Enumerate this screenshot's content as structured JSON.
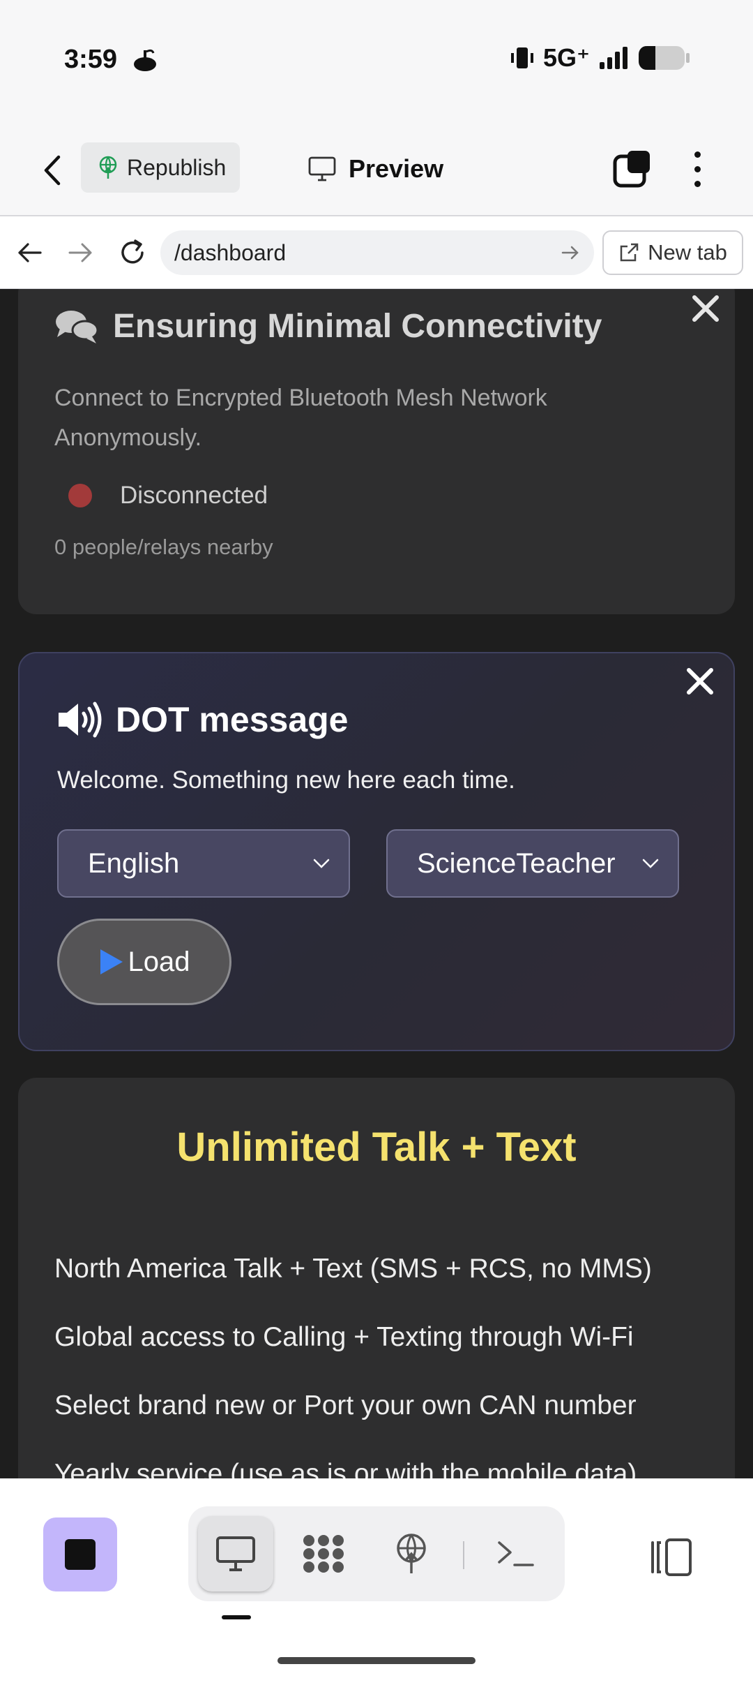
{
  "status_bar": {
    "time": "3:59",
    "network": "5G⁺"
  },
  "editor_header": {
    "republish_label": "Republish",
    "preview_label": "Preview"
  },
  "address_bar": {
    "url": "/dashboard",
    "new_tab_label": "New tab"
  },
  "connectivity_card": {
    "title": "Ensuring Minimal Connectivity",
    "description": "Connect to Encrypted Bluetooth Mesh Network Anonymously.",
    "status": "Disconnected",
    "status_color": "#a23a3a",
    "nearby_count": "0 people/relays nearby"
  },
  "dot_card": {
    "title": "DOT message",
    "description": "Welcome. Something new here each time.",
    "language_selected": "English",
    "persona_selected": "ScienceTeacher",
    "load_label": "Load",
    "play_icon_color": "#3b82f6"
  },
  "plan_card": {
    "title": "Unlimited Talk + Text",
    "title_color": "#f5e26e",
    "items": [
      "North America Talk + Text (SMS + RCS, no MMS)",
      "Global access to Calling + Texting through Wi-Fi",
      "Select brand new or Port your own CAN number",
      "Yearly service (use as is or with the mobile data)"
    ]
  },
  "bottom_bar": {
    "app_button_color": "#c3b6fb"
  }
}
